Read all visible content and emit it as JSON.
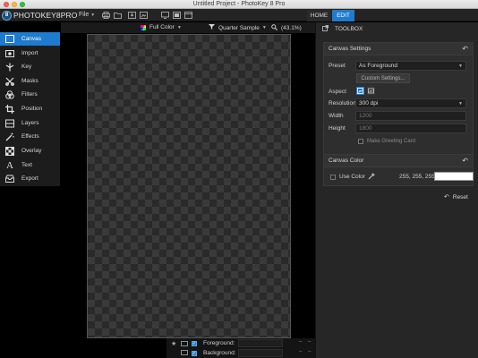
{
  "window": {
    "title": "Untitled Project - PhotoKey 8 Pro"
  },
  "app": {
    "logo_mark": "8",
    "logo_text": "PHOTOKEY8PRO"
  },
  "menu": {
    "file_label": "File"
  },
  "tabs": {
    "home": "HOME",
    "edit": "EDIT"
  },
  "view": {
    "color_mode": "Full Color",
    "sample_mode": "Quarter Sample",
    "zoom": "(43.1%)"
  },
  "sidebar": {
    "items": [
      {
        "label": "Canvas",
        "icon": "canvas-icon",
        "active": true
      },
      {
        "label": "Import",
        "icon": "import-icon"
      },
      {
        "label": "Key",
        "icon": "key-icon"
      },
      {
        "label": "Masks",
        "icon": "masks-icon"
      },
      {
        "label": "Filters",
        "icon": "filters-icon"
      },
      {
        "label": "Position",
        "icon": "position-icon"
      },
      {
        "label": "Layers",
        "icon": "layers-icon"
      },
      {
        "label": "Effects",
        "icon": "effects-icon"
      },
      {
        "label": "Overlay",
        "icon": "overlay-icon"
      },
      {
        "label": "Text",
        "icon": "text-icon"
      },
      {
        "label": "Export",
        "icon": "export-icon"
      }
    ]
  },
  "layers": {
    "foreground": "Foreground:",
    "background": "Background:"
  },
  "toolbox": {
    "title": "TOOLBOX",
    "canvas_settings": {
      "title": "Canvas Settings",
      "preset_label": "Preset",
      "preset_value": "As Foreground",
      "custom_button": "Custom Settings...",
      "aspect_label": "Aspect",
      "resolution_label": "Resolution",
      "resolution_value": "300 dpi",
      "width_label": "Width",
      "width_value": "1200",
      "height_label": "Height",
      "height_value": "1800",
      "greeting_label": "Make Greeting Card"
    },
    "canvas_color": {
      "title": "Canvas Color",
      "use_color_label": "Use Color",
      "rgb_value": "255, 255, 255",
      "swatch_color": "#ffffff"
    },
    "reset_label": "Reset"
  },
  "colors": {
    "accent": "#1f7bcd",
    "panel": "#2e2e2e",
    "background": "#000000"
  }
}
